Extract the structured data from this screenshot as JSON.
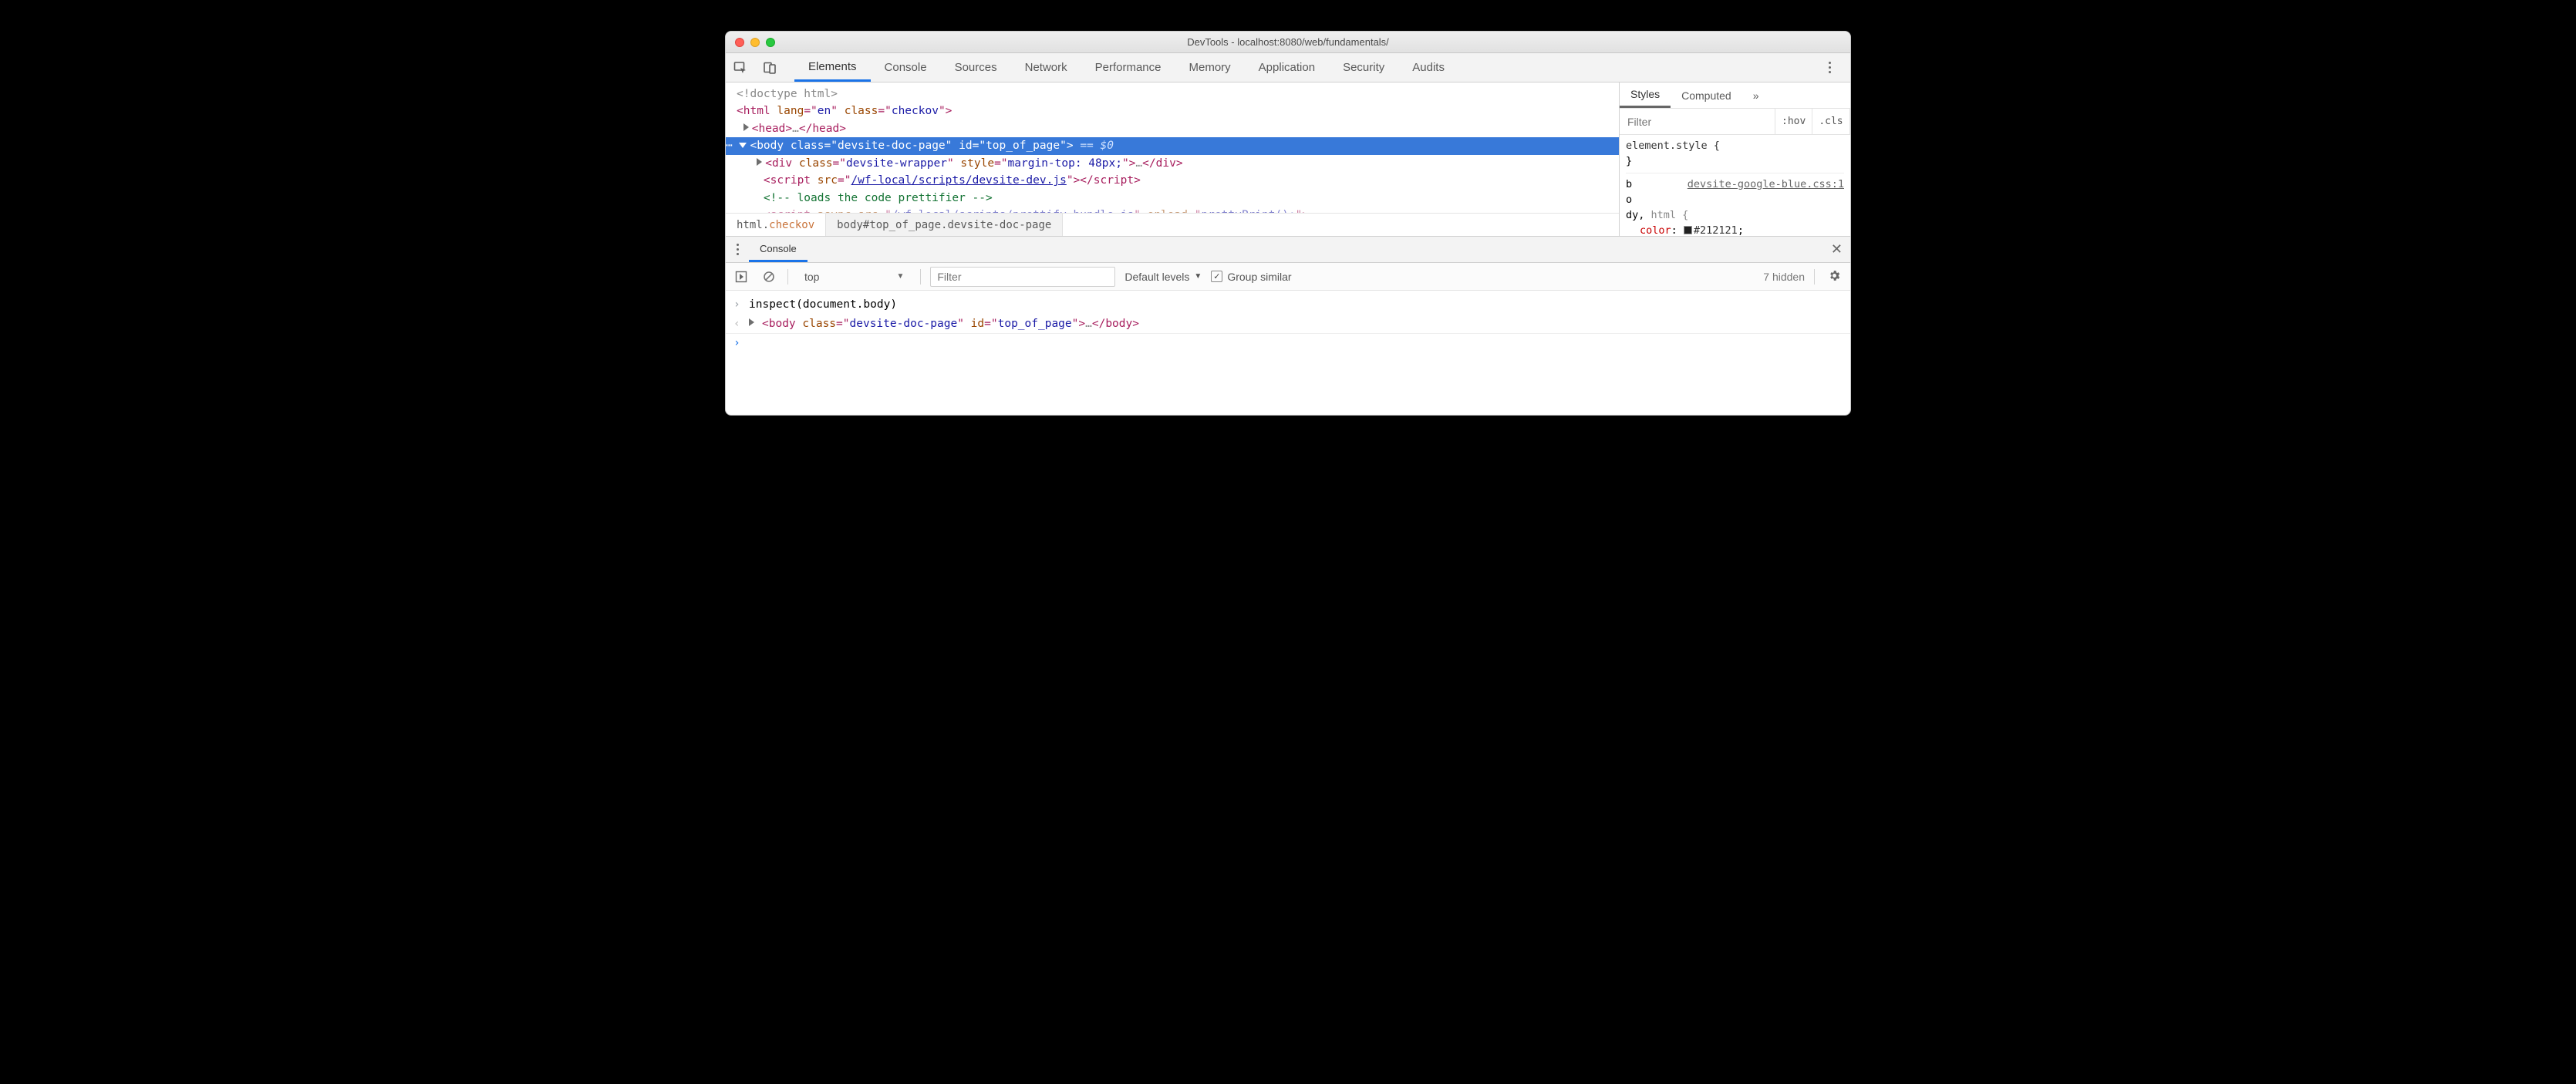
{
  "window_title": "DevTools - localhost:8080/web/fundamentals/",
  "toolbar_tabs": [
    "Elements",
    "Console",
    "Sources",
    "Network",
    "Performance",
    "Memory",
    "Application",
    "Security",
    "Audits"
  ],
  "active_toolbar_tab": "Elements",
  "dom": {
    "doctype": "<!doctype html>",
    "html_open": {
      "lang": "en",
      "class": "checkov"
    },
    "head_ellipsis": "…",
    "body": {
      "class": "devsite-doc-page",
      "id": "top_of_page",
      "suffix": "== $0"
    },
    "div": {
      "class": "devsite-wrapper",
      "style": "margin-top: 48px;",
      "ellipsis": "…"
    },
    "script1": {
      "src": "/wf-local/scripts/devsite-dev.js"
    },
    "comment": " loads the code prettifier ",
    "script2": {
      "src": "/wf-local/scripts/prettify-bundle.js",
      "onload": "prettyPrint();"
    }
  },
  "breadcrumbs": [
    {
      "tag": "html",
      "classes": [
        "checkov"
      ]
    },
    {
      "tag": "body",
      "id": "top_of_page",
      "classes": [
        "devsite-doc-page"
      ]
    }
  ],
  "styles_panel": {
    "tabs": [
      "Styles",
      "Computed"
    ],
    "filter_placeholder": "Filter",
    "pills": [
      ":hov",
      ".cls",
      "+"
    ],
    "element_style_label": "element.style",
    "rule_source": "devsite-google-blue.css:1",
    "rule_selector_prefix": [
      "b",
      "o",
      "dy, "
    ],
    "rule_selector_rest": "html {",
    "prop_name": "color",
    "prop_value": "#212121"
  },
  "console": {
    "tab_label": "Console",
    "context": "top",
    "filter_placeholder": "Filter",
    "levels_label": "Default levels",
    "group_similar_label": "Group similar",
    "hidden_label": "7 hidden",
    "input_line": "inspect(document.body)",
    "result": {
      "class": "devsite-doc-page",
      "id": "top_of_page"
    }
  }
}
